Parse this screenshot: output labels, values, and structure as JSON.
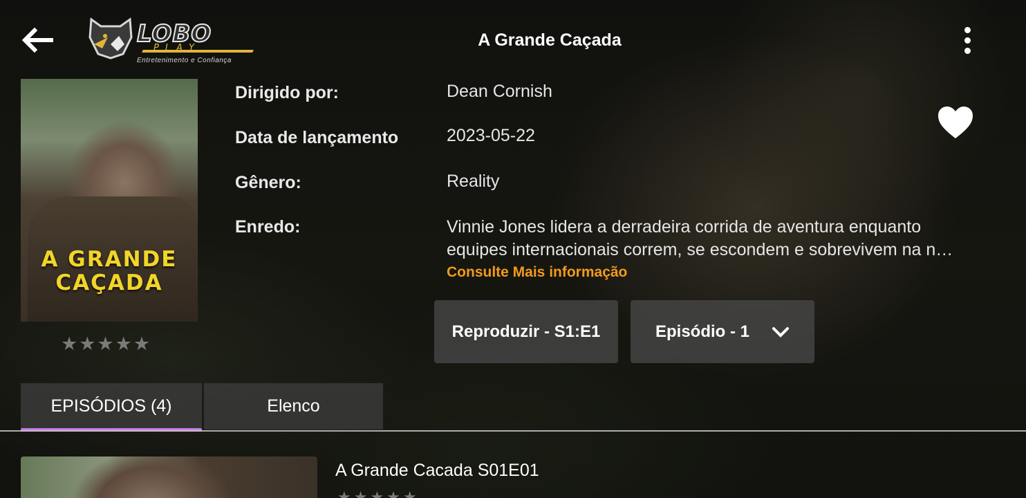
{
  "header": {
    "title": "A Grande Caçada",
    "back_icon": "arrow-left-icon",
    "more_icon": "more-vertical-icon"
  },
  "logo": {
    "word": "LOBO",
    "sub": "PLAY",
    "tagline": "Entretenimento e Confiança"
  },
  "poster": {
    "text_line1": "A GRANDE",
    "text_line2": "CAÇADA",
    "rating_stars": "★★★★★",
    "rating": 0
  },
  "info": {
    "director_label": "Dirigido por:",
    "director_value": "Dean Cornish",
    "release_label": "Data de lançamento",
    "release_value": "2023-05-22",
    "genre_label": "Gênero:",
    "genre_value": "Reality",
    "plot_label": "Enredo:",
    "plot_line1": "Vinnie Jones lidera a derradeira corrida de aventura enquanto",
    "plot_line2": "equipes internacionais correm, se escondem e sobrevivem na n…",
    "read_more": "Consulte Mais informação"
  },
  "actions": {
    "play_label": "Reproduzir - S1:E1",
    "episode_label": "Episódio - 1"
  },
  "tabs": [
    {
      "label": "EPISÓDIOS (4)",
      "active": true
    },
    {
      "label": "Elenco",
      "active": false
    }
  ],
  "episodes": [
    {
      "title": "A Grande Cacada S01E01",
      "stars": "★★★★★"
    }
  ],
  "colors": {
    "accent_tab": "#c67ee2",
    "read_more": "#f39a1c",
    "poster_title": "#f2d529",
    "logo_gold": "#e2b53a"
  }
}
